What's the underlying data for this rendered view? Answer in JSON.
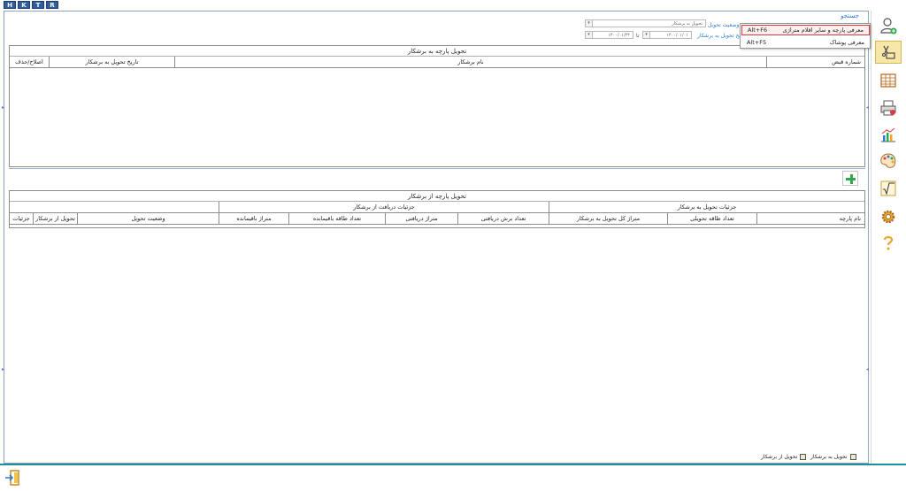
{
  "top_tabs": [
    "H",
    "K",
    "T",
    "R"
  ],
  "search_label": "جستجو",
  "filters": {
    "status_label": "وضعیت تحویل",
    "status_value": "تحویل به برشکار",
    "date_label": "تاریخ تحویل به برشکار",
    "date_from": "۱۴۰۰/۰۱/۰۱",
    "date_sep": "تا",
    "date_to": "۱۴۰۰/۰۱/۲۴"
  },
  "grid_top": {
    "title": "تحویل پارچه به برشکار",
    "columns": [
      "شماره قبض",
      "نام برشکار",
      "تاریخ تحویل به برشکار",
      "اصلاح/حذف"
    ]
  },
  "grid_bottom": {
    "title": "تحویل پارچه از برشکار",
    "groups": [
      "جزئیات تحویل به برشکار",
      "جزئیات دریافت از برشکار"
    ],
    "columns": [
      "نام پارچه",
      "تعداد طاقه تحویلی",
      "متراژ کل تحویل به برشکار",
      "تعداد برش دریافتی",
      "متراژ دریافتی",
      "تعداد طاقه باقیمانده",
      "متراژ باقیمانده",
      "وضعیت تحویل",
      "تحویل از برشکار",
      "جزئیات"
    ]
  },
  "legend": {
    "item1": "تحویل به برشکار",
    "item2": "تحویل از برشکار",
    "item1_color": "#e2f2c4",
    "item2_color": "#e2f2c4"
  },
  "context_menu": {
    "items": [
      {
        "label": "معرفی پارچه و سایر اقلام متراژی",
        "shortcut": "Alt+F6"
      },
      {
        "label": "معرفی پوشاک",
        "shortcut": "Alt+F5"
      }
    ]
  },
  "sidebar": {
    "icons": [
      "add-user-icon",
      "tailor-tools-icon",
      "table-icon",
      "printer-icon",
      "chart-icon",
      "palette-icon",
      "formula-icon",
      "gear-icon",
      "help-icon"
    ]
  },
  "colors": {
    "accent": "#2e7bd0",
    "add_green": "#2ea94a",
    "bottom_line": "#1c8f9b",
    "active_highlight": "#f8e7a8",
    "menu_highlight_border": "#e0383e"
  }
}
